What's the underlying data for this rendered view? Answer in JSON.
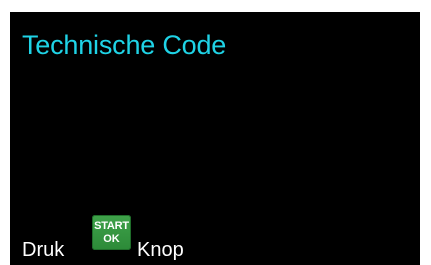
{
  "screen": {
    "title": "Technische Code",
    "colors": {
      "background": "#000000",
      "title": "#1fd3e6",
      "text": "#ffffff",
      "button": "#3a9c45"
    }
  },
  "footer": {
    "prefix": "Druk",
    "suffix": "Knop",
    "button": {
      "line1": "START",
      "line2": "OK",
      "icon": "start-ok-icon"
    }
  }
}
